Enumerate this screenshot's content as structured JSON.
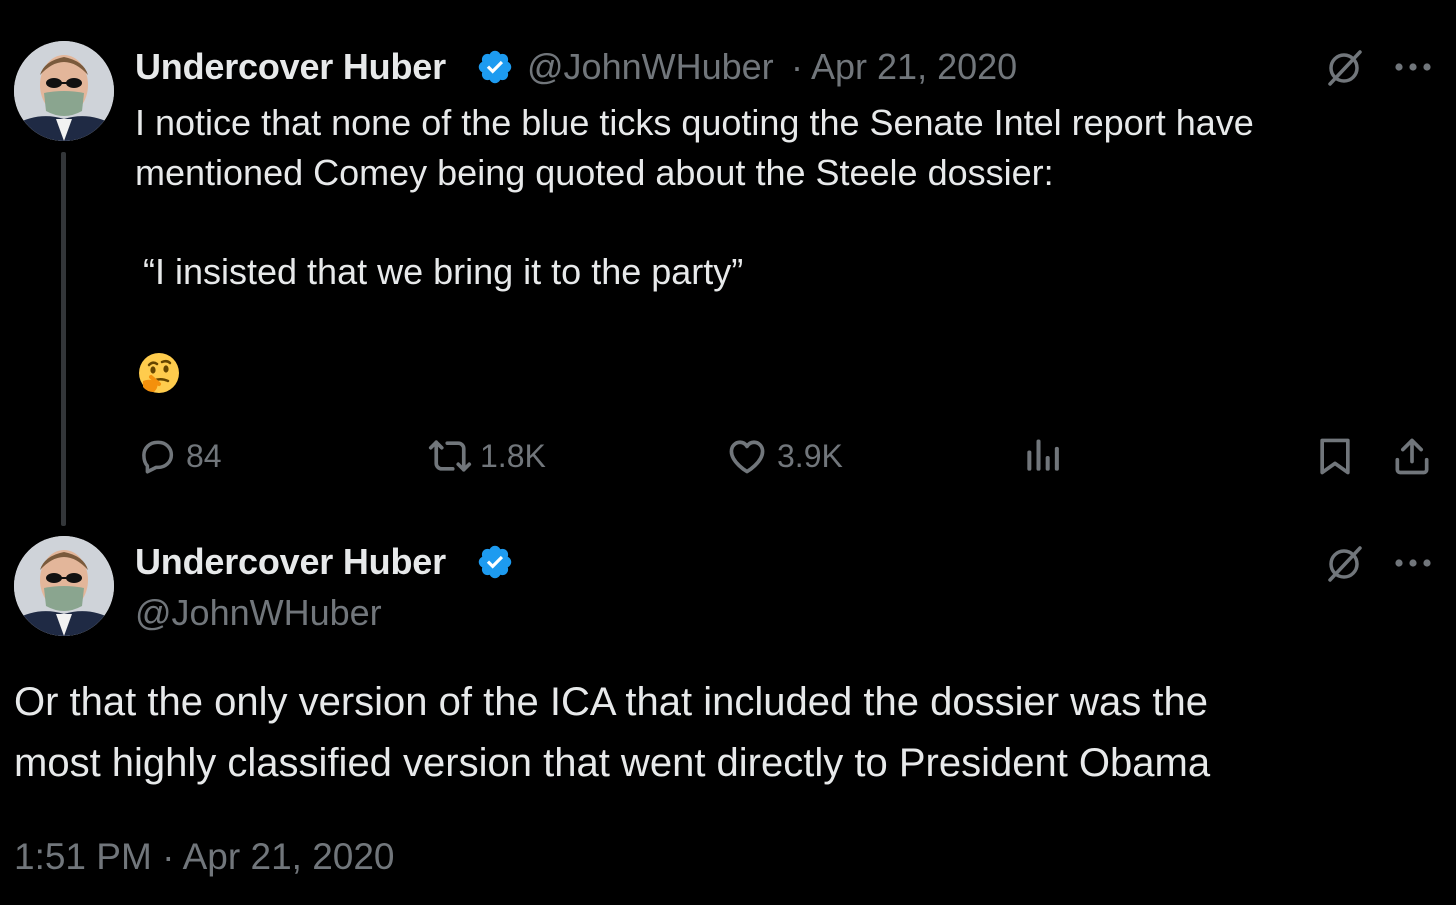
{
  "tweet1": {
    "display_name": "Undercover Huber",
    "handle": "@JohnWHuber",
    "date": "· Apr 21, 2020",
    "text_line1": "I notice that none of the blue ticks quoting the Senate Intel report have",
    "text_line2": "mentioned Comey being quoted about the Steele dossier:",
    "quote": "“I insisted that we bring it to the party”",
    "emoji": "thinking-face",
    "replies": "84",
    "reposts": "1.8K",
    "likes": "3.9K"
  },
  "tweet2": {
    "display_name": "Undercover Huber",
    "handle": "@JohnWHuber",
    "text_line1": "Or that the only version of the ICA that included the dossier was the",
    "text_line2": "most highly classified version that went directly to President Obama",
    "timestamp": "1:51 PM · Apr 21, 2020"
  },
  "icons": {
    "verified": "verified-badge-icon",
    "grok": "grok-icon",
    "more": "more-icon",
    "reply": "reply-icon",
    "repost": "repost-icon",
    "like": "like-icon",
    "views": "views-icon",
    "bookmark": "bookmark-icon",
    "share": "share-icon"
  },
  "colors": {
    "background": "#000000",
    "text": "#e7e9ea",
    "secondary": "#71767b",
    "verified": "#1d9bf0"
  }
}
